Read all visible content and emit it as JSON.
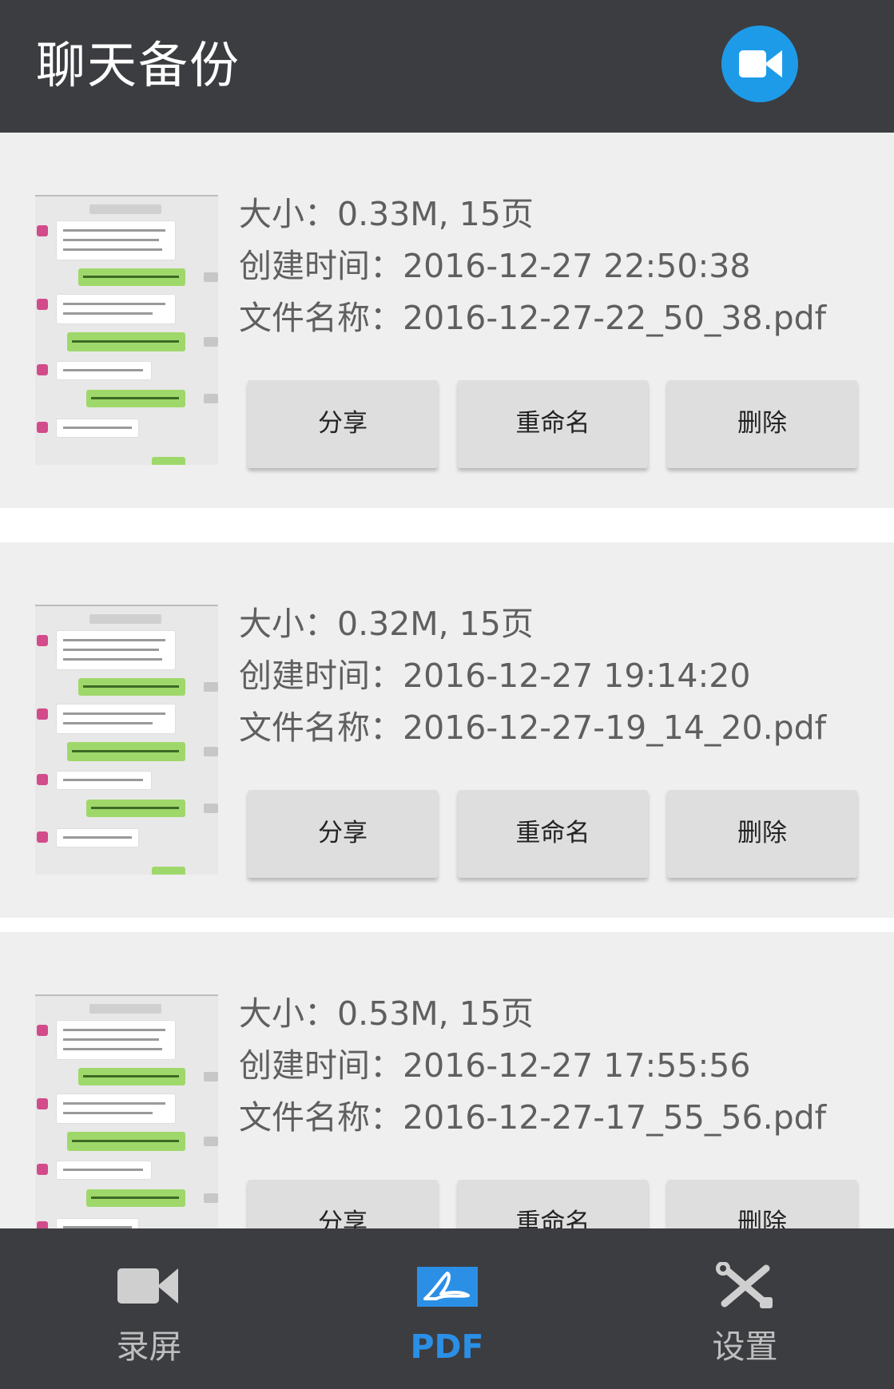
{
  "header": {
    "title": "聊天备份"
  },
  "records": [
    {
      "size": "大小：0.33M, 15页",
      "created": "创建时间：2016-12-27 22:50:38",
      "filename": "文件名称：2016-12-27-22_50_38.pdf",
      "actions": {
        "share": "分享",
        "rename": "重命名",
        "delete": "删除"
      }
    },
    {
      "size": "大小：0.32M, 15页",
      "created": "创建时间：2016-12-27 19:14:20",
      "filename": "文件名称：2016-12-27-19_14_20.pdf",
      "actions": {
        "share": "分享",
        "rename": "重命名",
        "delete": "删除"
      }
    },
    {
      "size": "大小：0.53M, 15页",
      "created": "创建时间：2016-12-27 17:55:56",
      "filename": "文件名称：2016-12-27-17_55_56.pdf",
      "actions": {
        "share": "分享",
        "rename": "重命名",
        "delete": "删除"
      }
    }
  ],
  "bottom_nav": {
    "items": [
      {
        "label": "录屏",
        "icon": "video-camera-icon"
      },
      {
        "label": "PDF",
        "icon": "pdf-icon"
      },
      {
        "label": "设置",
        "icon": "tools-icon"
      }
    ],
    "active_color": "#2b8fe6",
    "inactive_color": "#bfbfbf"
  },
  "colors": {
    "bar_background": "#3c3d41",
    "accent": "#1e9be8",
    "card_background": "#efefef"
  }
}
